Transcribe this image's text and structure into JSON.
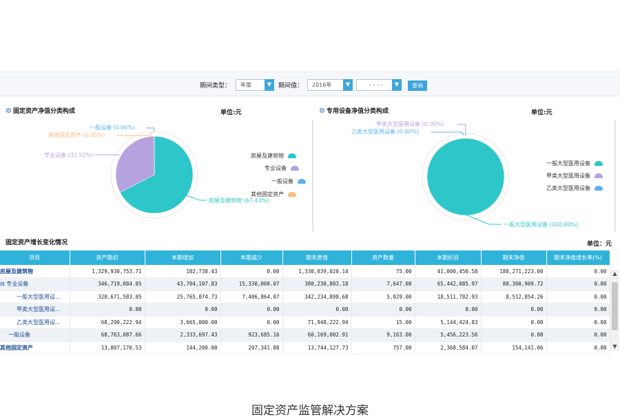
{
  "filter": {
    "period_type_label": "期间类型：",
    "period_type_value": "年度",
    "period_value_label": "期间值：",
    "year_value": "2016年",
    "month_value": "- - - -",
    "query_label": "查询"
  },
  "left_panel": {
    "title": "固定资产净值分类构成",
    "unit": "单位:元",
    "legend": [
      "房屋及建筑物",
      "专业设备",
      "一般设备",
      "其他固定资产"
    ],
    "slice_labels": [
      "房屋及建筑物  (67.43%)",
      "专业设备  (32.52%)",
      "其他固定资产  (0.05%)",
      "一般设备  (0.00%)"
    ]
  },
  "right_panel": {
    "title": "专用设备净值分类构成",
    "unit": "单位:元",
    "legend": [
      "一般大型医用设备",
      "甲类大型医用设备",
      "乙类大型医用设备"
    ],
    "slice_labels": [
      "一般大型医用设备  (100.00%)",
      "甲类大型医用设备  (0.00%)",
      "乙类大型医用设备  (0.00%)"
    ]
  },
  "chart_data": [
    {
      "type": "pie",
      "title": "固定资产净值分类构成",
      "categories": [
        "房屋及建筑物",
        "专业设备",
        "其他固定资产",
        "一般设备"
      ],
      "values": [
        67.43,
        32.52,
        0.05,
        0.0
      ],
      "colors": [
        "#2ec7c9",
        "#b6a2de",
        "#ffb980",
        "#5ab1ef"
      ]
    },
    {
      "type": "pie",
      "title": "专用设备净值分类构成",
      "categories": [
        "一般大型医用设备",
        "甲类大型医用设备",
        "乙类大型医用设备"
      ],
      "values": [
        100.0,
        0.0,
        0.0
      ],
      "colors": [
        "#2ec7c9",
        "#b6a2de",
        "#5ab1ef"
      ]
    }
  ],
  "table": {
    "title": "固定资产增长变化情况",
    "unit": "单位：元",
    "headers": [
      "项目",
      "资产期初",
      "本期增加",
      "本期减少",
      "期末原值",
      "资产数量",
      "本期折旧",
      "期末净值",
      "期末净值增长率(%)"
    ],
    "rows": [
      [
        "房屋及建筑物",
        "1,329,930,753.71",
        "102,738.43",
        "0.00",
        "1,330,039,020.14",
        "75.00",
        "41,000,450.58",
        "188,271,223.00",
        "0.00"
      ],
      [
        "⊟ 专业设备",
        "346,719,084.05",
        "43,704,107.83",
        "15,330,000.07",
        "380,230,803.18",
        "7,647.00",
        "65,442,085.97",
        "80,300,909.72",
        "0.00"
      ],
      [
        "一般大型医用设...",
        "320,671,583.05",
        "25,765,074.73",
        "7,406,864.07",
        "342,234,898.68",
        "5,029.00",
        "18,511,782.93",
        "8,512,854.26",
        "0.00"
      ],
      [
        "甲类大型医用设...",
        "0.00",
        "0.00",
        "0.00",
        "0.00",
        "0.00",
        "0.00",
        "0.00",
        "0.00"
      ],
      [
        "乙类大型医用设...",
        "68,290,222.94",
        "3,665,000.00",
        "0.00",
        "71,948,222.94",
        "15.00",
        "5,144,424.83",
        "0.00",
        "0.00"
      ],
      [
        "一般设备",
        "68,763,087.66",
        "2,333,697.43",
        "923,685.16",
        "60,169,002.91",
        "9,163.00",
        "5,456,223.56",
        "0.00",
        "0.00"
      ],
      [
        "其他固定资产",
        "13,807,170.53",
        "144,200.00",
        "207,341.80",
        "13,744,127.73",
        "757.00",
        "2,368,584.07",
        "154,141.06",
        "0.00"
      ]
    ]
  },
  "caption": "固定资产监管解决方案"
}
